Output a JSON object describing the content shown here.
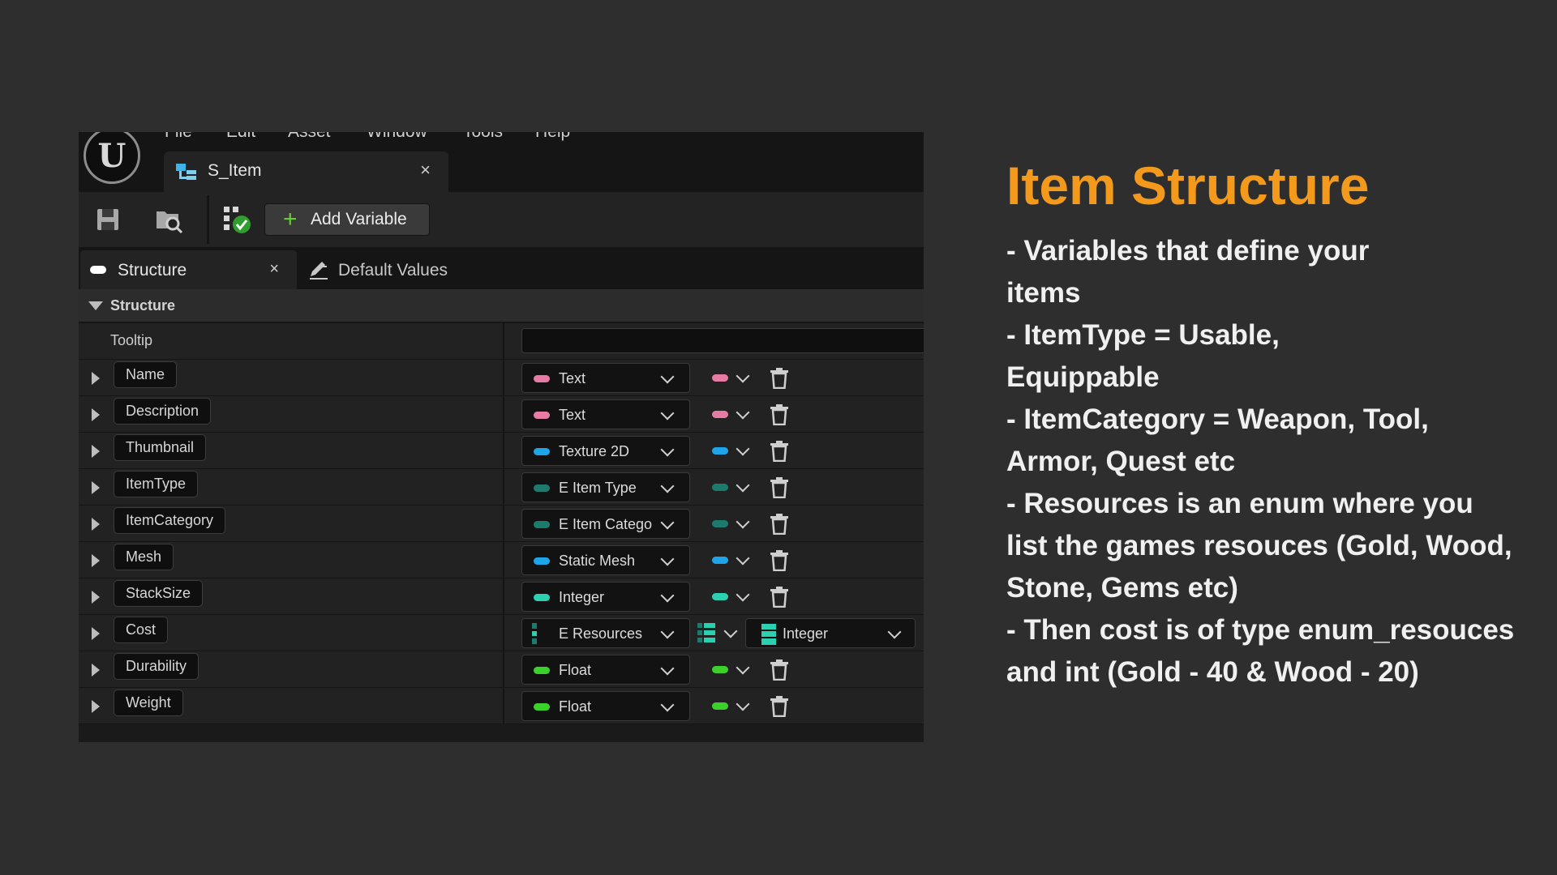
{
  "menu": [
    "File",
    "Edit",
    "Asset",
    "Window",
    "Tools",
    "Help"
  ],
  "document_tab": {
    "label": "S_Item",
    "close": "×"
  },
  "toolbar": {
    "add_variable": "Add Variable"
  },
  "panel_tabs": {
    "structure": "Structure",
    "structure_close": "×",
    "default_values": "Default Values"
  },
  "section": {
    "title": "Structure",
    "tooltip_label": "Tooltip",
    "tooltip_value": ""
  },
  "colors": {
    "text": "#e87aa6",
    "object": "#1ea4e8",
    "enum": "#1d7b6e",
    "integer": "#2ad0b0",
    "float": "#3bd12b",
    "accent": "#f39a1c"
  },
  "variables": [
    {
      "name": "Name",
      "type": "Text",
      "color": "#e87aa6"
    },
    {
      "name": "Description",
      "type": "Text",
      "color": "#e87aa6"
    },
    {
      "name": "Thumbnail",
      "type": "Texture 2D",
      "color": "#1ea4e8"
    },
    {
      "name": "ItemType",
      "type": "E Item Type",
      "color": "#1d7b6e"
    },
    {
      "name": "ItemCategory",
      "type": "E Item Category",
      "color": "#1d7b6e"
    },
    {
      "name": "Mesh",
      "type": "Static Mesh",
      "color": "#1ea4e8"
    },
    {
      "name": "StackSize",
      "type": "Integer",
      "color": "#2ad0b0"
    },
    {
      "name": "Cost",
      "type": "E Resources",
      "color": "#1d7b6e",
      "value_type": "Integer"
    },
    {
      "name": "Durability",
      "type": "Float",
      "color": "#3bd12b"
    },
    {
      "name": "Weight",
      "type": "Float",
      "color": "#3bd12b"
    }
  ],
  "info": {
    "title": "Item Structure",
    "lines": [
      "- Variables that define your",
      "items",
      "- ItemType = Usable,",
      "Equippable",
      "- ItemCategory = Weapon, Tool,",
      "Armor, Quest etc",
      "- Resources is an enum where you",
      "list the games resouces (Gold, Wood,",
      "Stone, Gems etc)",
      "- Then cost is of type enum_resouces",
      "and int (Gold - 40 & Wood - 20)"
    ]
  }
}
